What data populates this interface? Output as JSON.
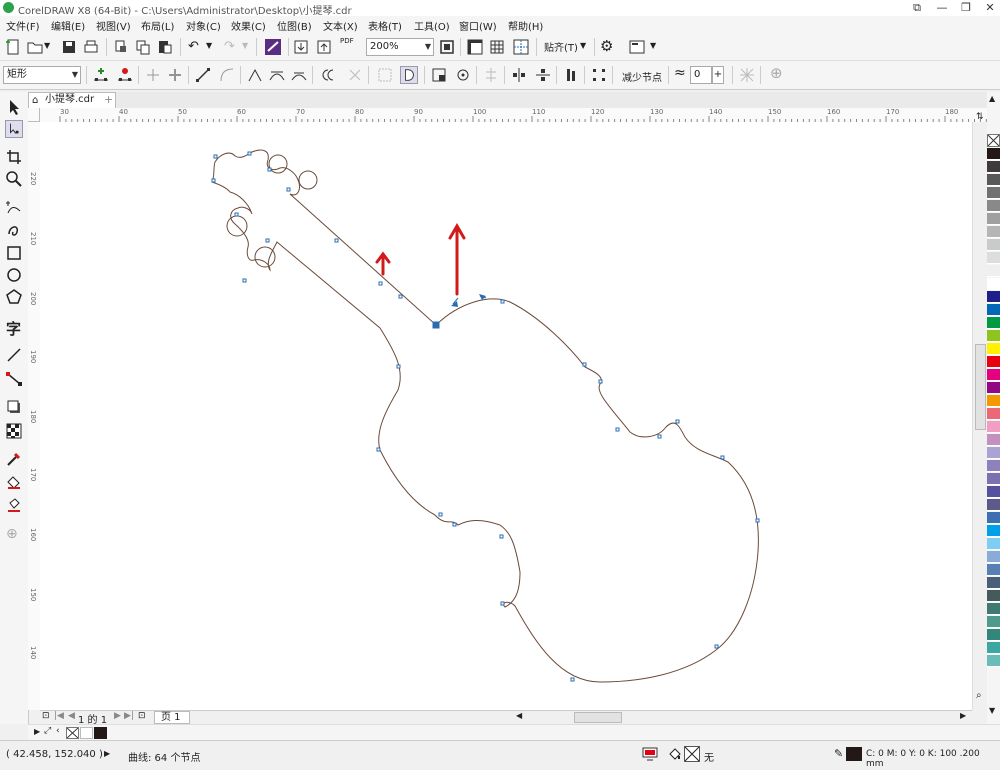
{
  "window": {
    "title": "CorelDRAW X8 (64-Bit) - C:\\Users\\Administrator\\Desktop\\小提琴.cdr"
  },
  "menu": [
    "文件(F)",
    "编辑(E)",
    "视图(V)",
    "布局(L)",
    "对象(C)",
    "效果(C)",
    "位图(B)",
    "文本(X)",
    "表格(T)",
    "工具(O)",
    "窗口(W)",
    "帮助(H)"
  ],
  "toolbar": {
    "zoom": "200%",
    "snap_label": "贴齐(T)",
    "pdf_label": "PDF"
  },
  "property_bar": {
    "object_type": "矩形",
    "reduce_nodes": "减少节点",
    "smoothing_value": "0"
  },
  "document_tab": {
    "name": "小提琴.cdr"
  },
  "ruler": {
    "h_labels": [
      "30",
      "40",
      "50",
      "60",
      "70",
      "80",
      "90",
      "100",
      "110",
      "120",
      "130",
      "140",
      "150",
      "160",
      "170",
      "180"
    ],
    "v_labels": [
      "220",
      "210",
      "200",
      "190",
      "180",
      "170",
      "160",
      "150",
      "140"
    ]
  },
  "page_nav": {
    "position": "1 的 1",
    "page_label": "页 1"
  },
  "status": {
    "coords": "( 42.458, 152.040 )",
    "info": "曲线: 64 个节点",
    "fill_none": "无",
    "outline_spec": "C: 0 M: 0 Y: 0 K: 100  .200 mm"
  },
  "colors": {
    "arrow": "#d31a1a",
    "outline": "#6b4a3a",
    "node": "#2a6cb0"
  },
  "palette": [
    "#231815",
    "#3e3a39",
    "#595757",
    "#727171",
    "#898989",
    "#9fa0a0",
    "#b5b5b6",
    "#c9caca",
    "#dcdddd",
    "#efefef",
    "#ffffff",
    "#1d2088",
    "#0068b7",
    "#009944",
    "#8fc31f",
    "#fff100",
    "#e60012",
    "#e4007f",
    "#920783",
    "#f39800",
    "#eb6877",
    "#f19ec2",
    "#c490bf",
    "#aaa4d4",
    "#8f82bc",
    "#7b71b1",
    "#56519e",
    "#5c5a8a",
    "#3e6fb0",
    "#00a0e9",
    "#7ecef4",
    "#88abda",
    "#5a7fb5",
    "#4b5f7b",
    "#445a5b",
    "#3e7a6f",
    "#4f9a8c",
    "#33877a",
    "#3ca7a0",
    "#6bbcb6"
  ]
}
